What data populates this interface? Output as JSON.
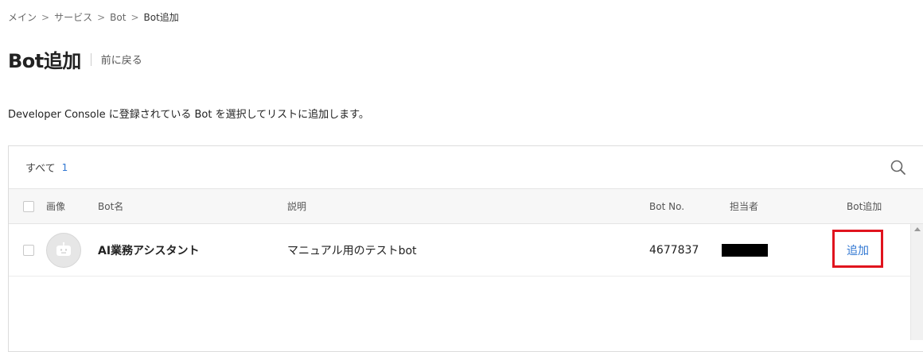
{
  "breadcrumb": {
    "items": [
      "メイン",
      "サービス",
      "Bot",
      "Bot追加"
    ],
    "separator": ">"
  },
  "header": {
    "title": "Bot追加",
    "back_label": "前に戻る"
  },
  "description": "Developer Console に登録されている Bot を選択してリストに追加します。",
  "filter": {
    "label": "すべて",
    "count": "1",
    "search_icon": "search-icon"
  },
  "table": {
    "columns": {
      "image": "画像",
      "name": "Bot名",
      "desc": "説明",
      "no": "Bot No.",
      "owner": "担当者",
      "add": "Bot追加"
    },
    "rows": [
      {
        "avatar_icon": "robot-icon",
        "name": "AI業務アシスタント",
        "description": "マニュアル用のテストbot",
        "bot_no": "4677837",
        "owner": "(redacted)",
        "add_label": "追加"
      }
    ]
  },
  "colors": {
    "link": "#2f76d2",
    "highlight": "#e0141e"
  }
}
